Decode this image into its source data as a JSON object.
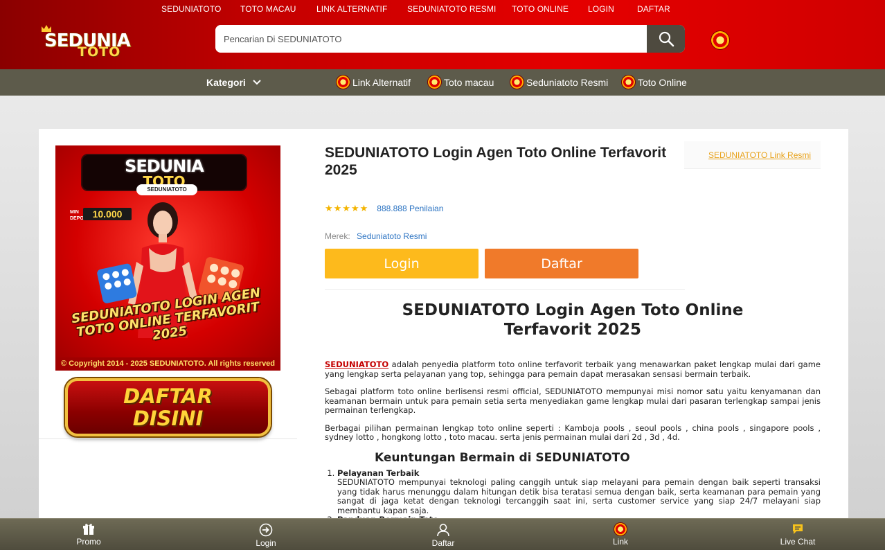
{
  "topnav": [
    "SEDUNIATOTO",
    "TOTO MACAU",
    "LINK ALTERNATIF",
    "SEDUNIATOTO RESMI",
    "TOTO ONLINE",
    "LOGIN",
    "DAFTAR"
  ],
  "logo": {
    "word1": "SEDUNIA",
    "word2": "TOTO"
  },
  "search": {
    "placeholder": "Pencarian Di SEDUNIATOTO",
    "icon": "search-icon"
  },
  "subnav": {
    "kategori": "Kategori",
    "items": [
      "Link Alternatif",
      "Toto macau",
      "Seduniatoto Resmi",
      "Toto Online"
    ]
  },
  "banner": {
    "logo_line1": "SEDUNIA",
    "logo_line2": "TOTO",
    "tag": "SEDUNIATOTO",
    "depo_label": "MIN DEPO",
    "depo_value": "10.000",
    "slogan": "SEDUNIATOTO LOGIN AGEN TOTO ONLINE TERFAVORIT 2025",
    "copyright": "© Copyright 2014 - 2025 SEDUNIATOTO. All rights reserved",
    "cta_line1": "DAFTAR",
    "cta_line2": "DISINI"
  },
  "product": {
    "title": "SEDUNIATOTO Login Agen Toto Online Terfavorit 2025",
    "side_link": "SEDUNIATOTO Link Resmi",
    "stars": "★★★★★",
    "rating_count": "888.888 Penilaian",
    "brand_label": "Merek:",
    "brand_value": "Seduniatoto Resmi",
    "login_label": "Login",
    "daftar_label": "Daftar"
  },
  "article": {
    "heading": "SEDUNIATOTO Login Agen Toto Online Terfavorit 2025",
    "p1_link": "SEDUNIATOTO",
    "p1_rest": " adalah penyedia platform toto online terfavorit terbaik yang menawarkan paket lengkap mulai dari game yang lengkap serta pelayanan yang top, sehingga para pemain dapat merasakan sensasi bermain terbaik.",
    "p2": "Sebagai platform toto online berlisensi resmi official, SEDUNIATOTO mempunyai misi nomor satu yaitu kenyamanan dan keamanan bermain untuk para pemain setia serta menyediakan game lengkap mulai dari pasaran terlengkap sampai jenis permainan terlengkap.",
    "p3": "Berbagai pilihan permainan lengkap toto online seperti : Kamboja pools , seoul pools , china pools , singapore pools , sydney lotto , hongkong lotto , toto macau. serta jenis permainan mulai dari 2d , 3d , 4d.",
    "subheading": "Keuntungan Bermain di SEDUNIATOTO",
    "list": [
      {
        "title": "Pelayanan Terbaik",
        "desc": "SEDUNIATOTO mempunyai teknologi paling canggih untuk siap melayani para pemain dengan baik seperti transaksi yang tidak harus menunggu dalam hitungan detik bisa teratasi semua dengan baik, serta keamanan para pemain yang sangat di jaga ketat dengan teknologi tercanggih saat ini, serta customer service yang siap 24/7 melayani siap membantu kapan saja."
      },
      {
        "title": "Panduan Bermain Toto",
        "desc": ""
      }
    ]
  },
  "bottombar": [
    {
      "label": "Promo",
      "icon": "gift-icon"
    },
    {
      "label": "Login",
      "icon": "login-icon"
    },
    {
      "label": "Daftar",
      "icon": "user-icon"
    },
    {
      "label": "Link",
      "icon": "chip-icon"
    },
    {
      "label": "Live Chat",
      "icon": "chat-icon"
    }
  ],
  "colors": {
    "header_red": "#e50000",
    "subnav": "#5d5b4b",
    "login": "#fdba1c",
    "daftar": "#f07a2a",
    "link_blue": "#2b73c2"
  }
}
